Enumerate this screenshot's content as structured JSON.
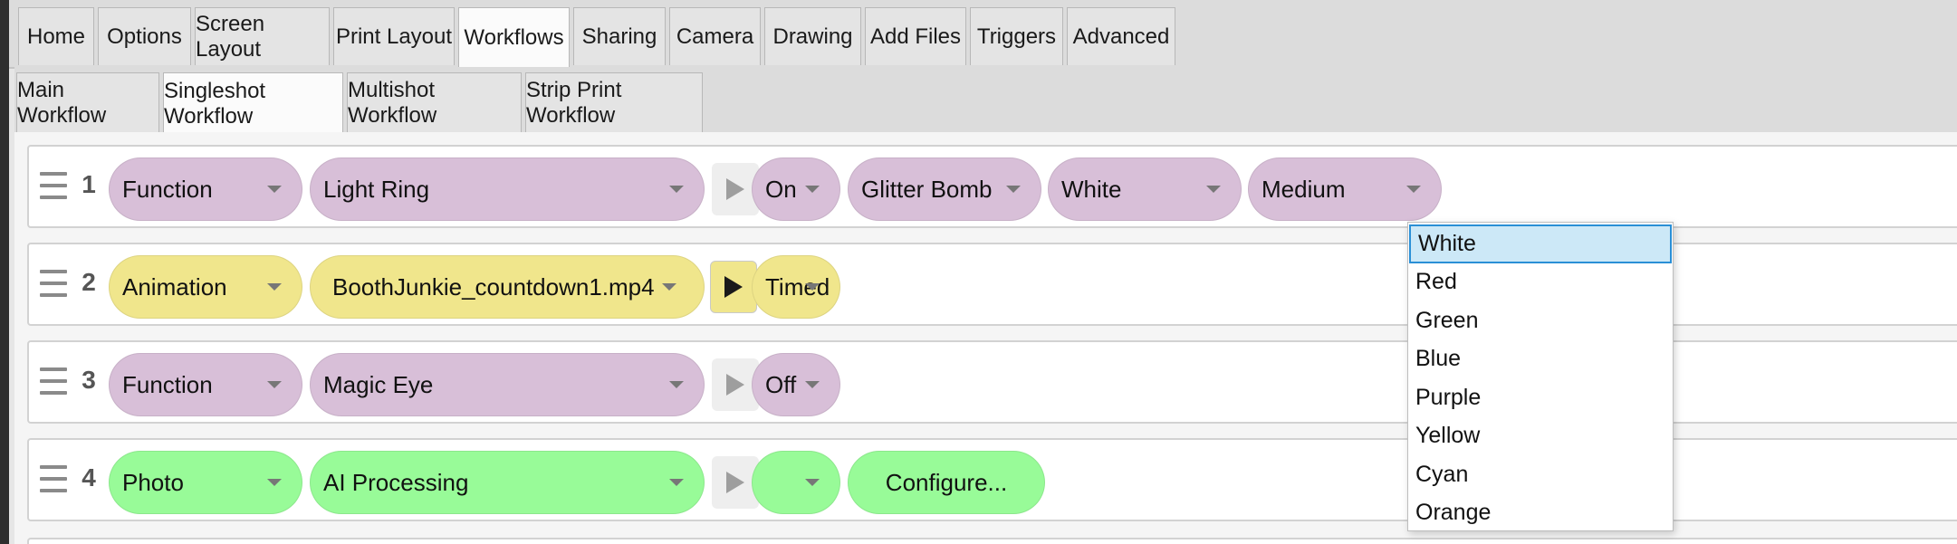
{
  "top_tabs": [
    {
      "label": "Home",
      "active": false
    },
    {
      "label": "Options",
      "active": false
    },
    {
      "label": "Screen Layout",
      "active": false
    },
    {
      "label": "Print Layout",
      "active": false
    },
    {
      "label": "Workflows",
      "active": true
    },
    {
      "label": "Sharing",
      "active": false
    },
    {
      "label": "Camera",
      "active": false
    },
    {
      "label": "Drawing",
      "active": false
    },
    {
      "label": "Add Files",
      "active": false
    },
    {
      "label": "Triggers",
      "active": false
    },
    {
      "label": "Advanced",
      "active": false
    }
  ],
  "sub_tabs": [
    {
      "label": "Main Workflow",
      "active": false
    },
    {
      "label": "Singleshot Workflow",
      "active": true
    },
    {
      "label": "Multishot Workflow",
      "active": false
    },
    {
      "label": "Strip Print Workflow",
      "active": false
    }
  ],
  "rows": [
    {
      "number": "1",
      "type": "Function",
      "item": "Light Ring",
      "mode": "On",
      "opt1": "Glitter Bomb",
      "opt2": "White",
      "opt3": "Medium"
    },
    {
      "number": "2",
      "type": "Animation",
      "item": "BoothJunkie_countdown1.mp4",
      "mode": "Timed"
    },
    {
      "number": "3",
      "type": "Function",
      "item": "Magic Eye",
      "mode": "Off"
    },
    {
      "number": "4",
      "type": "Photo",
      "item": "AI Processing",
      "mode": "",
      "configure": "Configure..."
    }
  ],
  "color_dropdown": {
    "selected": "White",
    "options": [
      "White",
      "Red",
      "Green",
      "Blue",
      "Purple",
      "Yellow",
      "Cyan",
      "Orange"
    ]
  },
  "colors": {
    "function_pill": "#d8bfd8",
    "animation_pill": "#f0e68c",
    "photo_pill": "#98fb98",
    "selection_border": "#2a8fd6",
    "selection_fill": "#cce8f7"
  },
  "icons": {
    "drag": "drag-handle-icon",
    "play": "play-icon",
    "dropdown": "chevron-down-icon"
  }
}
